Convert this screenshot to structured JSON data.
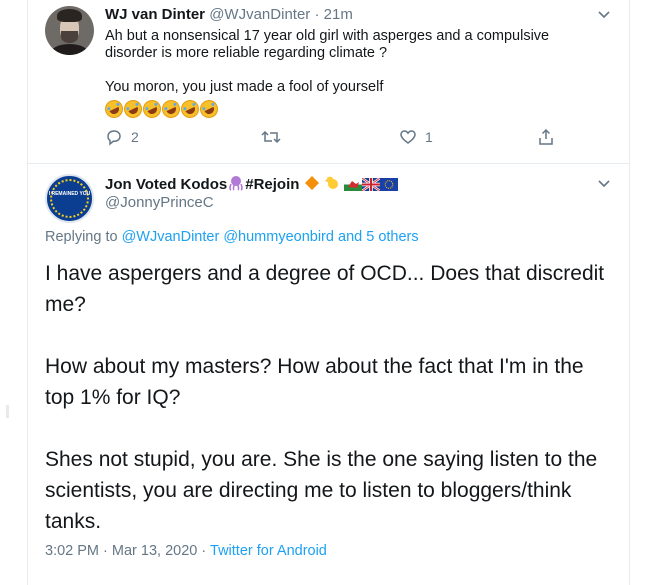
{
  "tweet1": {
    "display_name": "WJ van Dinter",
    "handle": "@WJvanDinter",
    "separator": "·",
    "time": "21m",
    "line1": "Ah but a nonsensical 17 year old girl with asperges and a compulsive",
    "line2": "disorder is more reliable regarding climate ?",
    "line3": "You moron, you just made a fool of yourself",
    "emoji_name": "rolling-on-floor-laughing",
    "emoji_count": 6,
    "reply_count": "2",
    "retweet_count": "",
    "like_count": "1"
  },
  "tweet2": {
    "display_name": "Jon Voted Kodos",
    "name_tag": "#Rejoin",
    "handle": "@JonnyPrinceC",
    "avatar_text": "I REMAINED YOU",
    "replying_prefix": "Replying to",
    "reply_user1": "@WJvanDinter",
    "reply_user2": "@hummyeonbird",
    "reply_and": "and",
    "reply_others": "5 others",
    "para1": "I have aspergers and a degree of OCD... Does that discredit me?",
    "para2": "How about my masters? How about the fact that I'm in the top 1% for IQ?",
    "para3": "Shes not stupid, you are. She is the one saying listen to the scientists, you are directing me to listen to bloggers/think tanks.",
    "time": "3:02 PM",
    "separator1": "·",
    "date": "Mar 13, 2020",
    "separator2": "·",
    "source": "Twitter for Android"
  },
  "icons": {
    "reply": "reply-icon",
    "retweet": "retweet-icon",
    "like": "heart-icon",
    "share": "share-icon",
    "more": "chevron-down-icon"
  },
  "colors": {
    "link": "#1da1f2",
    "secondary_text": "#657786",
    "primary_text": "#14171a"
  }
}
